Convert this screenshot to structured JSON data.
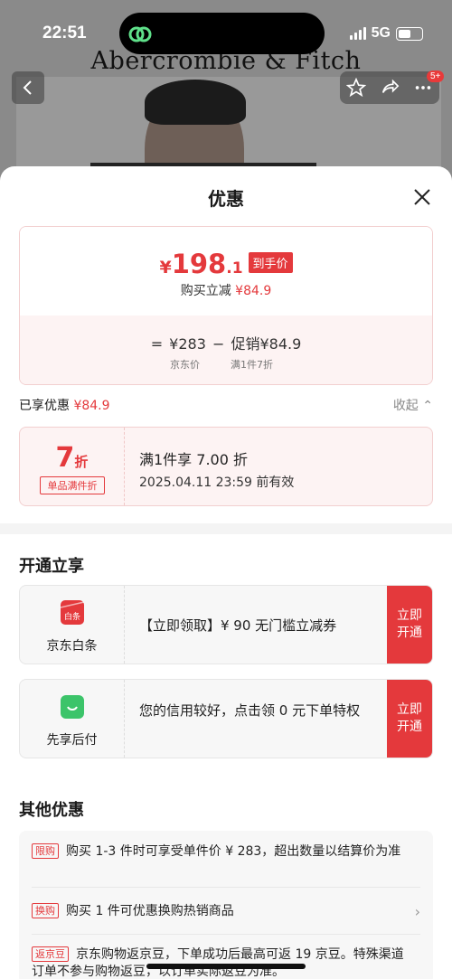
{
  "status_bar": {
    "time": "22:51",
    "network": "5G"
  },
  "background_page": {
    "brand": "Abercrombie & Fitch",
    "notification_count": "5+"
  },
  "sheet": {
    "title": "优惠",
    "price_card": {
      "currency": "¥",
      "price_int": "198",
      "price_dec": ".1",
      "price_tag": "到手价",
      "sub_label": "购买立减",
      "sub_amount": "¥84.9",
      "calc": "= ¥283 − 促销¥84.9",
      "label_jd_price": "京东价",
      "label_promo": "满1件7折"
    },
    "enjoyed": {
      "label": "已享优惠",
      "amount": "¥84.9",
      "collapse": "收起"
    },
    "discount": {
      "number": "7",
      "unit": "折",
      "tag": "单品满件折",
      "line1": "满1件享 7.00 折",
      "line2": "2025.04.11 23:59 前有效"
    },
    "open_section": {
      "title": "开通立享",
      "items": [
        {
          "icon": "baitiao-icon",
          "icon_text": "白条",
          "name": "京东白条",
          "text": "【立即领取】¥ 90 无门槛立减券",
          "button": "立即开通"
        },
        {
          "icon": "bag-icon",
          "name": "先享后付",
          "text": "您的信用较好，点击领 0 元下单特权",
          "button": "立即开通"
        }
      ]
    },
    "other_section": {
      "title": "其他优惠",
      "items": [
        {
          "tag": "限购",
          "text": "购买 1-3 件时可享受单件价 ¥ 283，超出数量以结算价为准"
        },
        {
          "tag": "换购",
          "text": "购买 1 件可优惠换购热销商品"
        },
        {
          "tag": "返京豆",
          "text": "京东购物返京豆，下单成功后最高可返 19 京豆。特殊渠道订单不参与购物返豆，以订单实际返豆为准。"
        }
      ]
    }
  },
  "colors": {
    "accent": "#e4393c",
    "card_pink": "#fdf3f3",
    "card_gray": "#f7f7f7"
  }
}
